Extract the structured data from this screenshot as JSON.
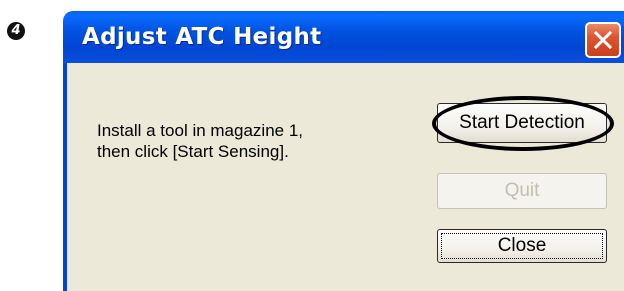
{
  "step_marker": "4",
  "dialog": {
    "title": "Adjust ATC Height",
    "message_lines": [
      "Install a tool in magazine 1,",
      "then click [Start Sensing]."
    ],
    "buttons": {
      "start": "Start Detection",
      "quit": "Quit",
      "close": "Close"
    }
  },
  "icons": {
    "close": "close-x-icon",
    "step": "numbered-circle-icon"
  },
  "colors": {
    "titlebar": "#0052e0",
    "client": "#ece9d8",
    "close_button": "#dc5730",
    "disabled_text": "#c2bfb0"
  }
}
